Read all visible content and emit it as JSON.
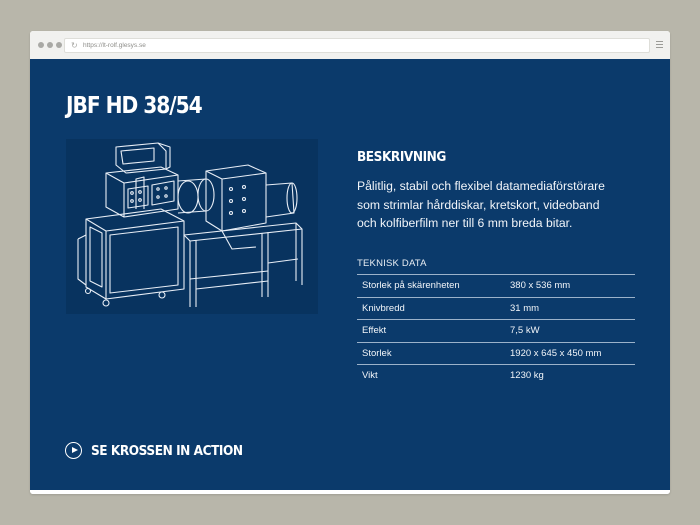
{
  "browser": {
    "url": "https://lt-rolf.glesys.se"
  },
  "page": {
    "title": "JBF HD 38/54",
    "description_heading": "BESKRIVNING",
    "description": "Pålitlig, stabil och flexibel datamediaförstörare som strimlar hårddiskar, kretskort, videoband och kolfiberfilm ner till 6 mm breda bitar.",
    "specs_heading": "TEKNISK DATA",
    "specs": [
      {
        "label": "Storlek på skärenheten",
        "value": "380 x 536 mm"
      },
      {
        "label": "Knivbredd",
        "value": "31 mm"
      },
      {
        "label": "Effekt",
        "value": "7,5 kW"
      },
      {
        "label": "Storlek",
        "value": "1920 x 645 x 450 mm"
      },
      {
        "label": "Vikt",
        "value": "1230 kg"
      }
    ],
    "cta_label": "SE KROSSEN IN ACTION"
  },
  "colors": {
    "page_background": "#0b3a6b",
    "outer_background": "#b8b6aa",
    "text": "#ffffff"
  }
}
